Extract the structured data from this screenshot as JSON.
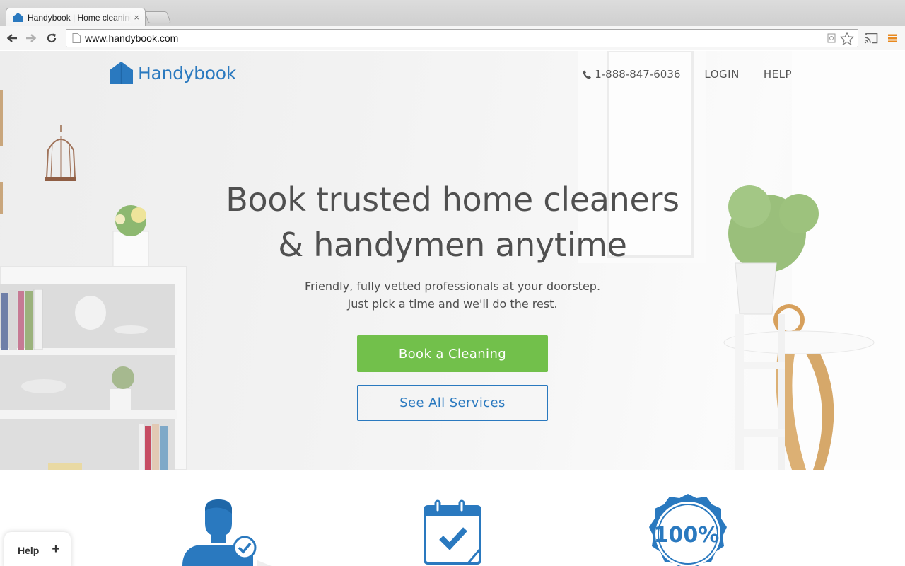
{
  "browser": {
    "tab_title": "Handybook | Home cleaning",
    "tab_close": "×",
    "url": "www.handybook.com"
  },
  "header": {
    "logo_text": "Handybook",
    "phone": "1-888-847-6036",
    "nav": [
      "LOGIN",
      "HELP"
    ]
  },
  "hero": {
    "headline_lines": [
      "Book trusted home cleaners",
      "& handymen anytime"
    ],
    "subhead_lines": [
      "Friendly, fully vetted professionals at your doorstep.",
      "Just pick a time and we'll do the rest."
    ],
    "primary_cta": "Book a Cleaning",
    "secondary_cta": "See All Services"
  },
  "features": {
    "guarantee_badge": "100%"
  },
  "help_widget": {
    "label": "Help",
    "plus": "+"
  },
  "colors": {
    "brand_blue": "#2a79bf",
    "cta_green": "#72c04b",
    "headline_gray": "#505050"
  },
  "icons": [
    "house-logo-icon",
    "phone-icon",
    "professional-check-icon",
    "calendar-check-icon",
    "guarantee-badge-icon"
  ]
}
